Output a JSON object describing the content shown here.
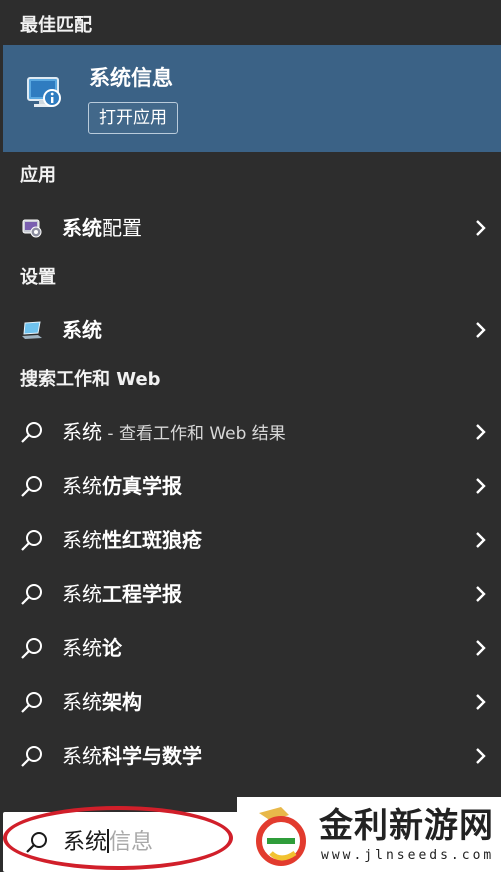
{
  "sections": {
    "best_match": "最佳匹配",
    "apps": "应用",
    "settings": "设置",
    "search_web": "搜索工作和 Web"
  },
  "best_match": {
    "title": "系统信息",
    "open_button": "打开应用",
    "icon": "system-information-icon"
  },
  "apps": [
    {
      "prefix": "系统",
      "bold": "配置",
      "icon": "system-configuration-icon"
    }
  ],
  "settings": [
    {
      "prefix": "系统",
      "bold": "",
      "icon": "system-settings-laptop-icon"
    }
  ],
  "web_results": [
    {
      "prefix": "系统",
      "suffix": " - 查看工作和 Web 结果",
      "bold": ""
    },
    {
      "prefix": "系统",
      "suffix": "",
      "bold": "仿真学报"
    },
    {
      "prefix": "系统",
      "suffix": "",
      "bold": "性红斑狼疮"
    },
    {
      "prefix": "系统",
      "suffix": "",
      "bold": "工程学报"
    },
    {
      "prefix": "系统",
      "suffix": "",
      "bold": "论"
    },
    {
      "prefix": "系统",
      "suffix": "",
      "bold": "架构"
    },
    {
      "prefix": "系统",
      "suffix": "",
      "bold": "科学与数学"
    }
  ],
  "search": {
    "typed": "系统",
    "ghost": "信息"
  },
  "watermark": {
    "name": "金利新游网",
    "url": "www.jlnseeds.com"
  },
  "colors": {
    "panel_bg": "#2d2d2d",
    "highlight_bg": "#3b6286",
    "annotation_red": "#d11f2a"
  }
}
